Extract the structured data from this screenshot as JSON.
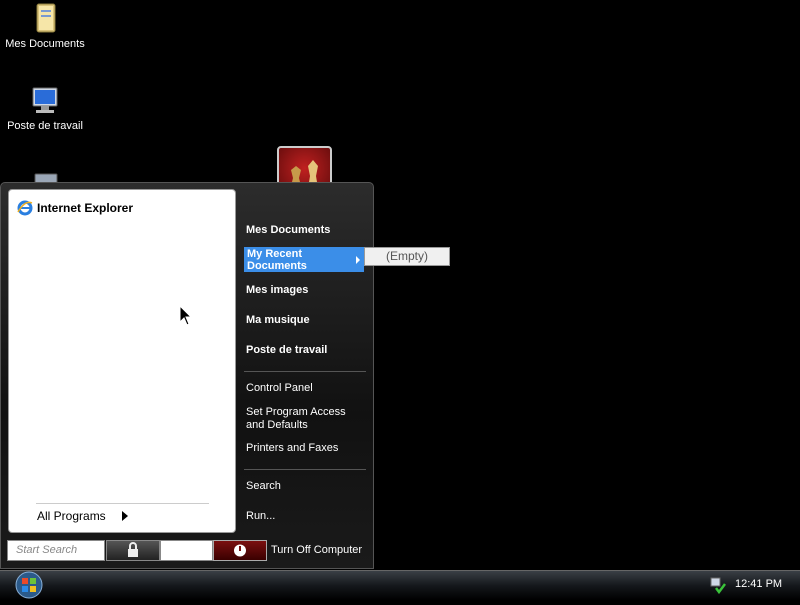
{
  "desktop": {
    "icons": [
      {
        "label": "Mes Documents",
        "icon": "folder-documents-icon"
      },
      {
        "label": "Poste de travail",
        "icon": "computer-icon"
      },
      {
        "label": "",
        "icon": "network-icon"
      }
    ]
  },
  "start_menu": {
    "pinned": [
      {
        "label": "Internet Explorer",
        "icon": "internet-explorer-icon"
      }
    ],
    "all_programs": "All Programs",
    "right_items": [
      {
        "label": "Mes Documents"
      },
      {
        "label": "My Recent Documents"
      },
      {
        "label": "Mes images"
      },
      {
        "label": "Ma musique"
      },
      {
        "label": "Poste de travail"
      },
      {
        "label": "Control Panel"
      },
      {
        "label": "Set Program Access and Defaults"
      },
      {
        "label": "Printers and Faxes"
      },
      {
        "label": "Search"
      },
      {
        "label": "Run..."
      }
    ],
    "recent_submenu": "(Empty)",
    "search_placeholder": "Start Search",
    "turn_off": "Turn Off Computer"
  },
  "taskbar": {
    "clock": "12:41 PM"
  },
  "colors": {
    "highlight": "#3b8ee8",
    "power_button": "#7a1010"
  }
}
